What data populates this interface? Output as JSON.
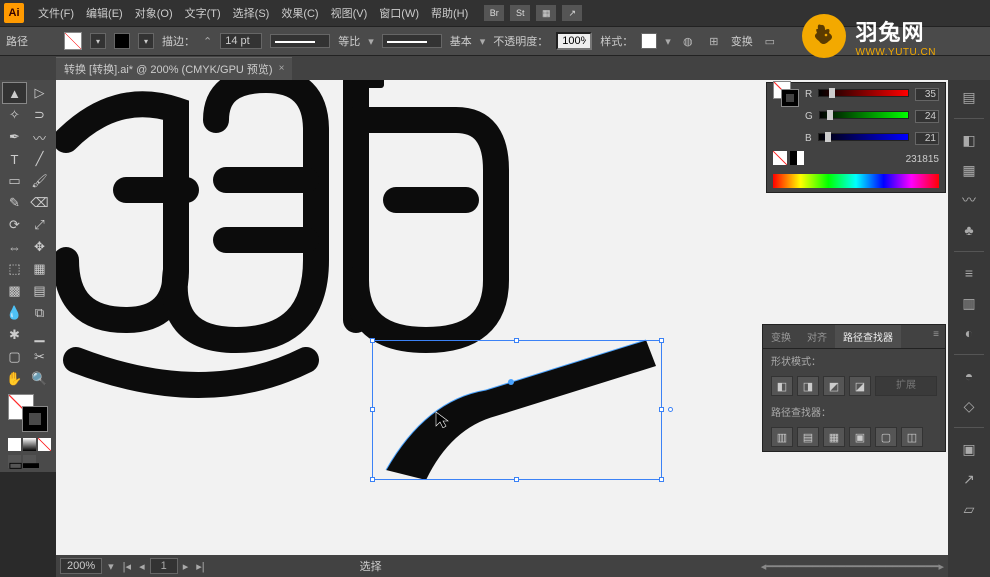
{
  "menu": {
    "items": [
      "文件(F)",
      "编辑(E)",
      "对象(O)",
      "文字(T)",
      "选择(S)",
      "效果(C)",
      "视图(V)",
      "窗口(W)",
      "帮助(H)"
    ],
    "ext": [
      "Br",
      "St",
      "▦",
      "↗"
    ]
  },
  "optbar": {
    "label": "路径",
    "stroke_label": "描边：",
    "stroke_val": "14 pt",
    "line_label1": "等比",
    "line_label2": "基本",
    "opacity_label": "不透明度：",
    "opacity_val": "100%",
    "style_label": "样式：",
    "trans_label": "变换"
  },
  "tab": {
    "title": "转换  [转换].ai* @ 200% (CMYK/GPU 预览)"
  },
  "color": {
    "r_label": "R",
    "r_val": "35",
    "g_label": "G",
    "g_val": "24",
    "b_label": "B",
    "b_val": "21",
    "hex": "231815"
  },
  "pathfinder": {
    "tabs": [
      "变换",
      "对齐",
      "路径查找器"
    ],
    "mode_label": "形状模式：",
    "pf_label": "路径查找器：",
    "expand": "扩展"
  },
  "status": {
    "zoom": "200%",
    "page": "1",
    "tool": "选择"
  },
  "logo": {
    "cn": "羽兔网",
    "url": "WWW.YUTU.CN"
  },
  "chart_data": null
}
